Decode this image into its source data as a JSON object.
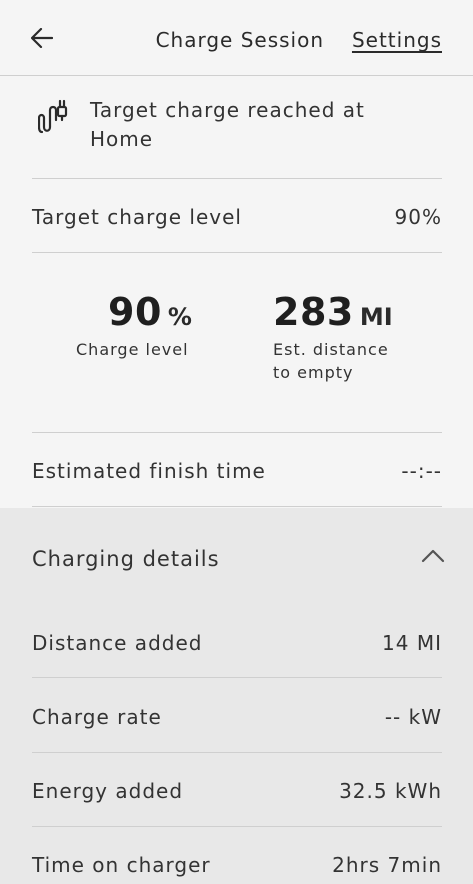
{
  "header": {
    "title": "Charge Session",
    "settings_label": "Settings"
  },
  "status": {
    "message": "Target charge reached at Home"
  },
  "target": {
    "label": "Target charge level",
    "value": "90%"
  },
  "metrics": {
    "charge": {
      "value": "90",
      "unit": "%",
      "label": "Charge level"
    },
    "distance": {
      "value": "283",
      "unit": "MI",
      "label": "Est. distance to empty"
    }
  },
  "finish": {
    "label": "Estimated finish time",
    "value": "--:--"
  },
  "details": {
    "title": "Charging details",
    "rows": [
      {
        "label": "Distance added",
        "value": "14 MI"
      },
      {
        "label": "Charge rate",
        "value": "-- kW"
      },
      {
        "label": "Energy added",
        "value": "32.5 kWh"
      },
      {
        "label": "Time on charger",
        "value": "2hrs 7min"
      }
    ]
  }
}
